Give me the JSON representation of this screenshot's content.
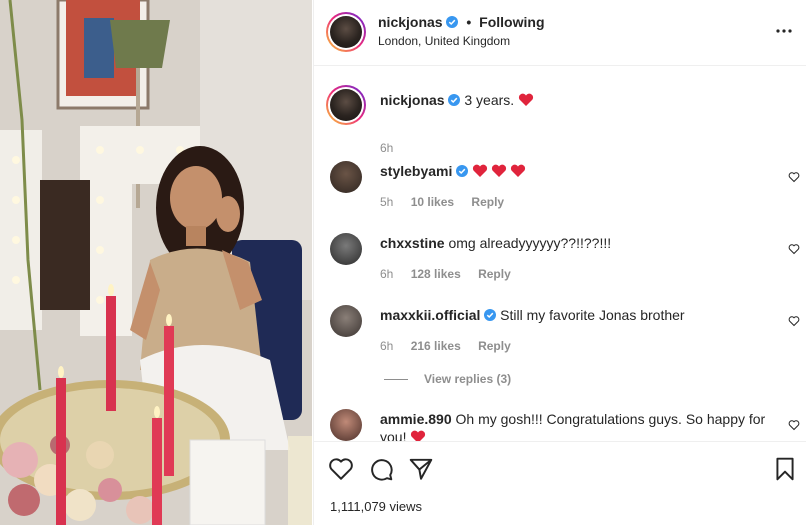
{
  "post": {
    "author": "nickjonas",
    "follow_status": "Following",
    "location": "London, United Kingdom",
    "caption_text": "3 years.",
    "caption_time": "6h",
    "views": "1,111,079 views"
  },
  "comments": [
    {
      "user": "stylebyami",
      "text": "",
      "emoji_hearts": 3,
      "time": "5h",
      "likes": "10 likes",
      "reply": "Reply",
      "verified": true
    },
    {
      "user": "chxxstine",
      "text": "omg alreadyyyyyy??!!??!!!",
      "time": "6h",
      "likes": "128 likes",
      "reply": "Reply",
      "verified": false
    },
    {
      "user": "maxxkii.official",
      "text": "Still my favorite Jonas brother",
      "time": "6h",
      "likes": "216 likes",
      "reply": "Reply",
      "verified": true
    },
    {
      "user": "ammie.890",
      "text": "Oh my gosh!!! Congratulations guys. So happy for",
      "text_line2": "you!",
      "verified": false
    }
  ],
  "view_replies": "View replies (3)",
  "colors": {
    "accent_blue": "#3897f0",
    "heart_red": "#ed4956",
    "muted": "#8e8e8e"
  },
  "icons": [
    "more-options-icon",
    "verified-badge-icon",
    "heart-icon",
    "comment-icon",
    "share-icon",
    "bookmark-icon"
  ]
}
